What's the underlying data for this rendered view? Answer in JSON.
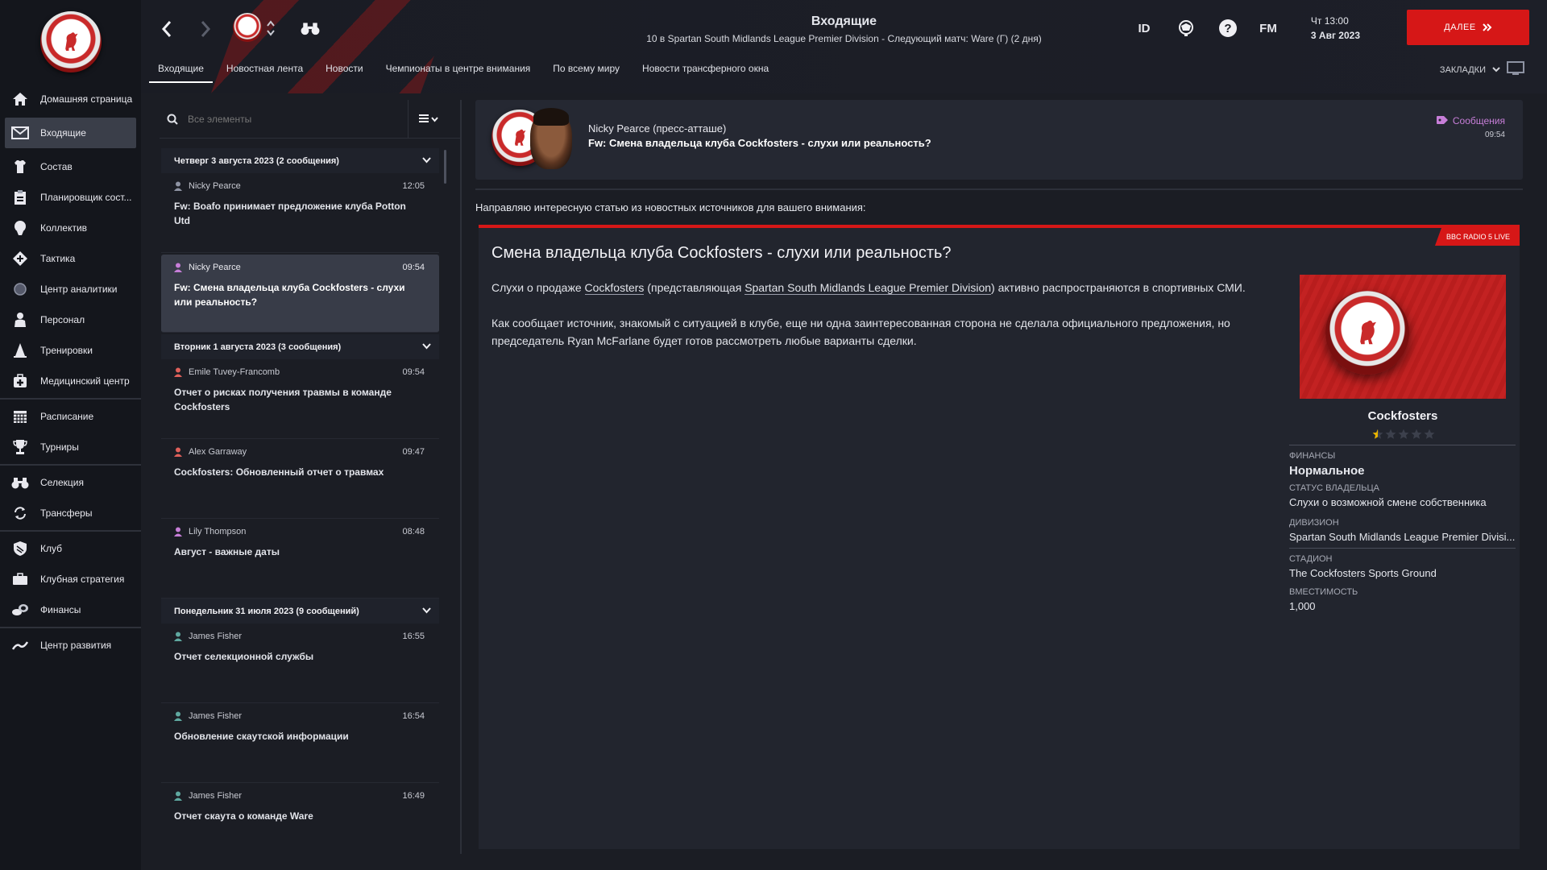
{
  "sidebar": {
    "items": [
      {
        "label": "Домашняя страница",
        "icon": "home-icon"
      },
      {
        "label": "Входящие",
        "icon": "envelope-icon"
      },
      {
        "label": "Состав",
        "icon": "jersey-icon"
      },
      {
        "label": "Планировщик сост...",
        "icon": "clipboard-icon"
      },
      {
        "label": "Коллектив",
        "icon": "team-icon"
      },
      {
        "label": "Тактика",
        "icon": "tactics-icon"
      },
      {
        "label": "Центр аналитики",
        "icon": "analytics-icon"
      },
      {
        "label": "Персонал",
        "icon": "staff-icon"
      },
      {
        "label": "Тренировки",
        "icon": "cone-icon"
      },
      {
        "label": "Медицинский центр",
        "icon": "medical-icon"
      },
      {
        "label": "Расписание",
        "icon": "calendar-icon"
      },
      {
        "label": "Турниры",
        "icon": "trophy-icon"
      },
      {
        "label": "Селекция",
        "icon": "binoculars-icon"
      },
      {
        "label": "Трансферы",
        "icon": "transfer-icon"
      },
      {
        "label": "Клуб",
        "icon": "shield-icon"
      },
      {
        "label": "Клубная стратегия",
        "icon": "briefcase-icon"
      },
      {
        "label": "Финансы",
        "icon": "money-icon"
      },
      {
        "label": "Центр развития",
        "icon": "development-icon"
      }
    ]
  },
  "header": {
    "title": "Входящие",
    "subtitle": "10 в Spartan South Midlands League Premier Division - Следующий матч: Ware (Г) (2 дня)",
    "tabs": [
      "Входящие",
      "Новостная лента",
      "Новости",
      "Чемпионаты в центре внимания",
      "По всему миру",
      "Новости трансферного окна"
    ],
    "id_label": "ID",
    "fm_label": "FM",
    "day_time": "Чт 13:00",
    "date": "3 Авг 2023",
    "next_label": "ДАЛЕЕ",
    "bookmarks_label": "ЗАКЛАДКИ"
  },
  "inbox": {
    "search_placeholder": "Все элементы",
    "groups": [
      {
        "title": "Четверг 3 августа 2023 (2 сообщения)",
        "messages": [
          {
            "sender": "Nicky Pearce",
            "time": "12:05",
            "subject": "Fw: Boafo принимает предложение клуба Potton Utd",
            "icon_color": "#8e93a3"
          },
          {
            "sender": "Nicky Pearce",
            "time": "09:54",
            "subject": "Fw: Смена владельца клуба Cockfosters - слухи или реальность?",
            "icon_color": "#c77ed8"
          }
        ]
      },
      {
        "title": "Вторник 1 августа 2023 (3 сообщения)",
        "messages": [
          {
            "sender": "Emile Tuvey-Francomb",
            "time": "09:54",
            "subject": "Отчет о рисках получения травмы в команде Cockfosters",
            "icon_color": "#e0605a"
          },
          {
            "sender": "Alex Garraway",
            "time": "09:47",
            "subject": "Cockfosters: Обновленный отчет о травмах",
            "icon_color": "#e0605a"
          },
          {
            "sender": "Lily Thompson",
            "time": "08:48",
            "subject": "Август - важные даты",
            "icon_color": "#c77ed8"
          }
        ]
      },
      {
        "title": "Понедельник 31 июля 2023 (9 сообщений)",
        "messages": [
          {
            "sender": "James Fisher",
            "time": "16:55",
            "subject": "Отчет селекционной службы",
            "icon_color": "#5fa8a0"
          },
          {
            "sender": "James Fisher",
            "time": "16:54",
            "subject": "Обновление скаутской информации",
            "icon_color": "#5fa8a0"
          },
          {
            "sender": "James Fisher",
            "time": "16:49",
            "subject": "Отчет скаута о команде Ware",
            "icon_color": "#5fa8a0"
          }
        ]
      }
    ]
  },
  "message": {
    "sender": "Nicky Pearce  (пресс-атташе)",
    "subject": "Fw: Смена владельца клуба Cockfosters - слухи или реальность?",
    "tag": "Сообщения",
    "time": "09:54",
    "intro": "Направляю интересную статью из новостных источников для вашего внимания:",
    "article": {
      "source": "BBC RADIO 5 LIVE",
      "title": "Смена владельца клуба Cockfosters - слухи или реальность?",
      "p1_a": "Слухи о продаже ",
      "p1_club": "Cockfosters",
      "p1_b": " (представляющая ",
      "p1_league": "Spartan South Midlands League Premier Division",
      "p1_c": ") активно распространяются в спортивных СМИ.",
      "p2": "Как сообщает источник, знакомый с ситуацией в клубе, еще ни одна заинтересованная сторона не сделала официального предложения, но председатель Ryan McFarlane будет готов рассмотреть любые варианты сделки."
    },
    "club": {
      "name": "Cockfosters",
      "rating_stars": 0.5,
      "max_stars": 5,
      "finance_label": "ФИНАНСЫ",
      "finance_value": "Нормальное",
      "owner_label": "СТАТУС ВЛАДЕЛЬЦА",
      "owner_value": "Слухи о возможной смене собственника",
      "division_label": "ДИВИЗИОН",
      "division_value": "Spartan South Midlands League Premier Divisi...",
      "stadium_label": "СТАДИОН",
      "stadium_value": "The Cockfosters Sports Ground",
      "capacity_label": "ВМЕСТИМОСТЬ",
      "capacity_value": "1,000"
    }
  },
  "colors": {
    "accent": "#d61717",
    "sidebar_bg": "#14161c",
    "panel_bg": "#22252e"
  }
}
